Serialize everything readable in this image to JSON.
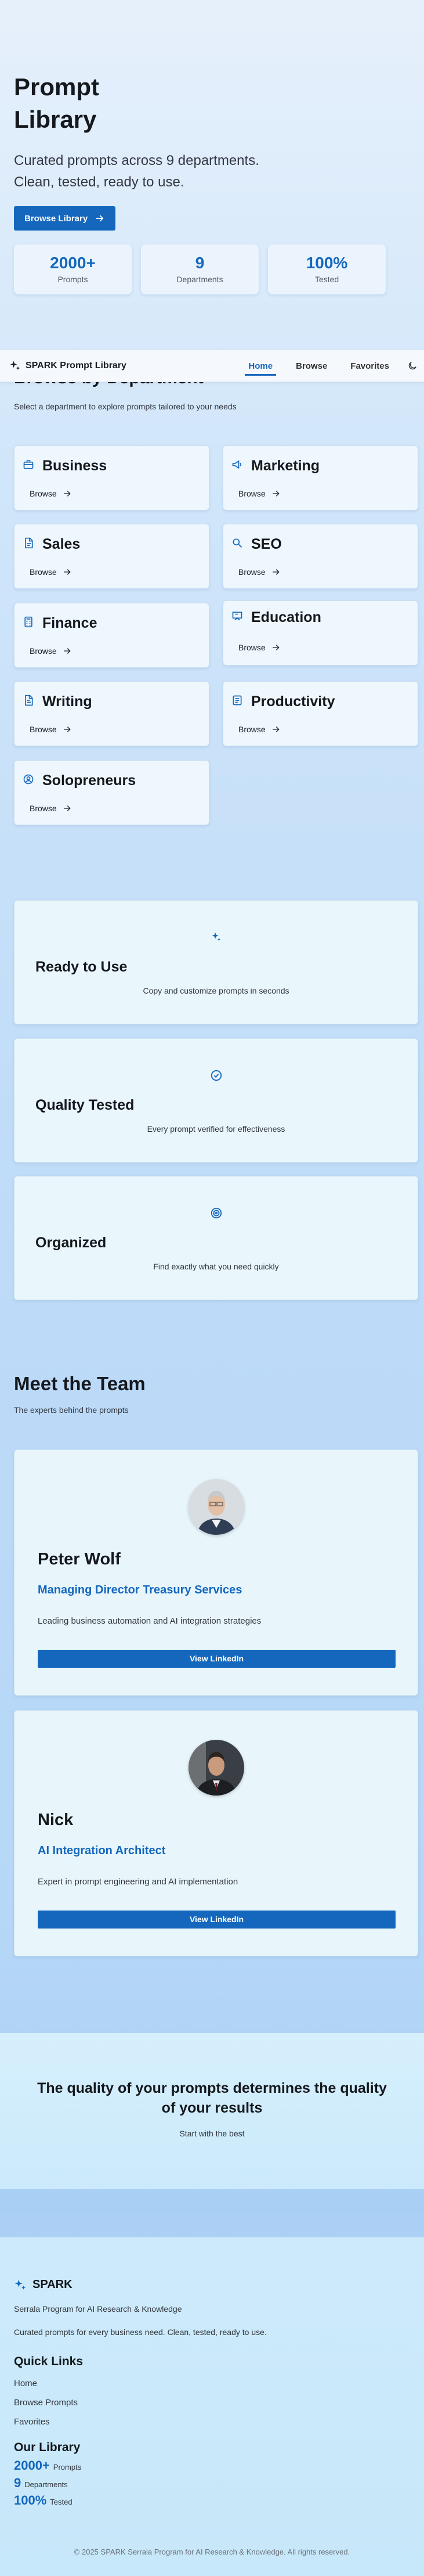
{
  "hero": {
    "title": "Prompt Library",
    "subtitle": "Curated prompts across 9 departments. Clean, tested, ready to use.",
    "cta_label": "Browse Library",
    "stats": [
      {
        "value": "2000+",
        "label": "Prompts"
      },
      {
        "value": "9",
        "label": "Departments"
      },
      {
        "value": "100%",
        "label": "Tested"
      }
    ]
  },
  "nav": {
    "brand": "SPARK Prompt Library",
    "links": [
      "Home",
      "Browse",
      "Favorites"
    ],
    "active": "Home",
    "theme_icon": "moon-icon"
  },
  "departments": {
    "title": "Browse by Department",
    "subtitle": "Select a department to explore prompts tailored to your needs",
    "browse_label": "Browse",
    "items": [
      {
        "name": "Business",
        "icon": "briefcase-icon"
      },
      {
        "name": "Marketing",
        "icon": "megaphone-icon"
      },
      {
        "name": "Sales",
        "icon": "document-icon"
      },
      {
        "name": "SEO",
        "icon": "search-icon"
      },
      {
        "name": "Finance",
        "icon": "calculator-icon"
      },
      {
        "name": "Education",
        "icon": "presentation-icon"
      },
      {
        "name": "Writing",
        "icon": "file-text-icon"
      },
      {
        "name": "Productivity",
        "icon": "checklist-icon"
      },
      {
        "name": "Solopreneurs",
        "icon": "user-circle-icon"
      }
    ]
  },
  "features": [
    {
      "title": "Ready to Use",
      "desc": "Copy and customize prompts in seconds",
      "icon": "sparkle-icon"
    },
    {
      "title": "Quality Tested",
      "desc": "Every prompt verified for effectiveness",
      "icon": "check-circle-icon"
    },
    {
      "title": "Organized",
      "desc": "Find exactly what you need quickly",
      "icon": "target-icon"
    }
  ],
  "team": {
    "title": "Meet the Team",
    "subtitle": "The experts behind the prompts",
    "members": [
      {
        "name": "Peter Wolf",
        "role": "Managing Director Treasury Services",
        "desc": "Leading business automation and AI integration strategies",
        "button": "View LinkedIn"
      },
      {
        "name": "Nick",
        "role": "AI Integration Architect",
        "desc": "Expert in prompt engineering and AI implementation",
        "button": "View LinkedIn"
      }
    ]
  },
  "quote": {
    "title": "The quality of your prompts determines the quality of your results",
    "subtitle": "Start with the best"
  },
  "footer": {
    "brand": "SPARK",
    "org": "Serrala Program for AI Research & Knowledge",
    "tagline": "Curated prompts for every business need. Clean, tested, ready to use.",
    "quick_links_title": "Quick Links",
    "quick_links": [
      "Home",
      "Browse Prompts",
      "Favorites"
    ],
    "library_title": "Our Library",
    "library_stats": [
      {
        "value": "2000+",
        "label": "Prompts"
      },
      {
        "value": "9",
        "label": "Departments"
      },
      {
        "value": "100%",
        "label": "Tested"
      }
    ],
    "copyright": "© 2025 SPARK Serrala Program for AI Research & Knowledge. All rights reserved."
  },
  "colors": {
    "accent": "#1467bd",
    "text": "#15181d",
    "card": "#eef7fd"
  }
}
